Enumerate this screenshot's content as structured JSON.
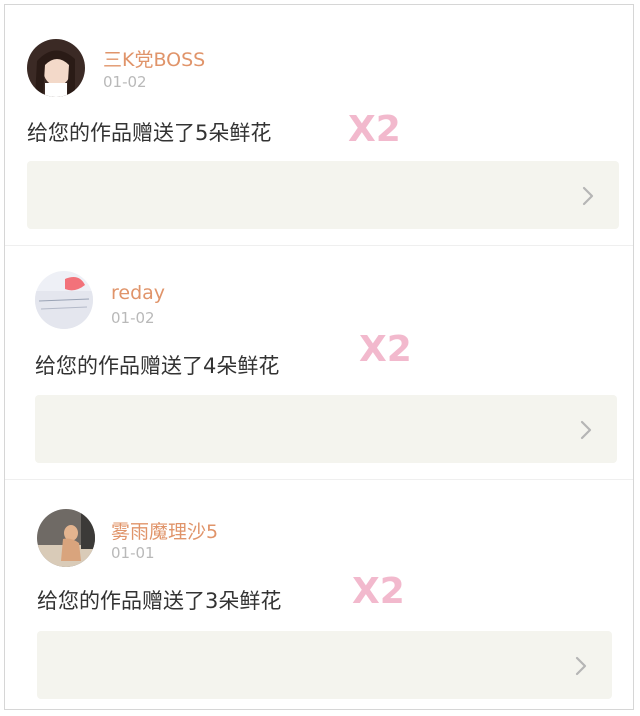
{
  "notifications": [
    {
      "username": "三K党BOSS",
      "date": "01-02",
      "message": "给您的作品赠送了5朵鲜花",
      "badge": "X2",
      "avatar_icon": "user-avatar-girl"
    },
    {
      "username": "reday",
      "date": "01-02",
      "message": "给您的作品赠送了4朵鲜花",
      "badge": "X2",
      "avatar_icon": "user-avatar-love-note"
    },
    {
      "username": "雾雨魔理沙5",
      "date": "01-01",
      "message": "给您的作品赠送了3朵鲜花",
      "badge": "X2",
      "avatar_icon": "user-avatar-photo"
    }
  ],
  "colors": {
    "username": "#e0946a",
    "date": "#b9b9b9",
    "message": "#333333",
    "badge": "#f2b9cd",
    "card_bg": "#f4f4ee"
  }
}
